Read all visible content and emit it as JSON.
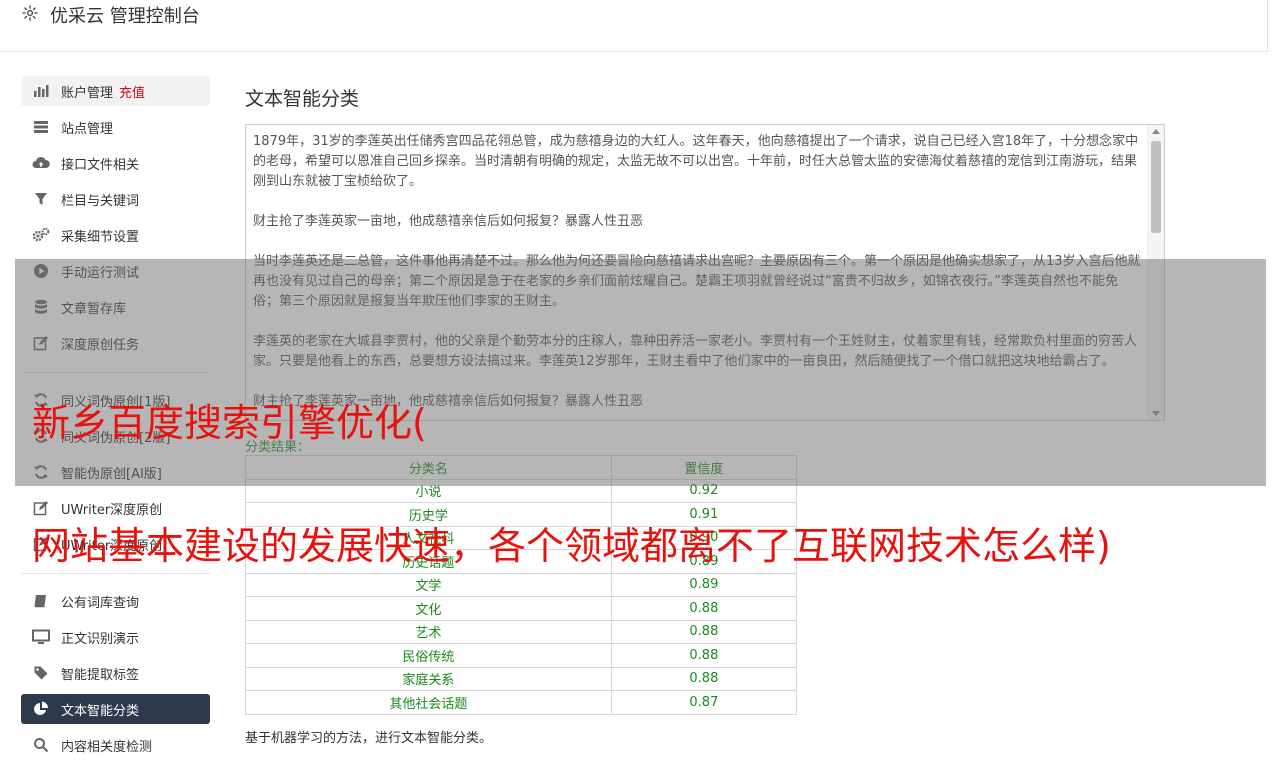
{
  "header": {
    "title": "优采云 管理控制台",
    "gear_icon": "gear-icon"
  },
  "sidebar": {
    "items": [
      {
        "label": "账户管理",
        "extra": "充值",
        "icon": "bar-chart-icon"
      },
      {
        "label": "站点管理",
        "icon": "server-icon"
      },
      {
        "label": "接口文件相关",
        "icon": "cloud-upload-icon"
      },
      {
        "label": "栏目与关键词",
        "icon": "filter-icon"
      },
      {
        "label": "采集细节设置",
        "icon": "gears-icon"
      },
      {
        "label": "手动运行测试",
        "icon": "play-icon"
      },
      {
        "label": "文章暂存库",
        "icon": "database-icon"
      },
      {
        "label": "深度原创任务",
        "icon": "edit-icon"
      },
      {
        "label": "同义词伪原创[1版]",
        "icon": "refresh-icon"
      },
      {
        "label": "同义词伪原创[2版]",
        "icon": "refresh-icon"
      },
      {
        "label": "智能伪原创[AI版]",
        "icon": "refresh-icon"
      },
      {
        "label": "UWriter深度原创",
        "icon": "edit-icon"
      },
      {
        "label": "UWriter深度原创",
        "icon": "edit-icon"
      },
      {
        "label": "公有词库查询",
        "icon": "book-icon"
      },
      {
        "label": "正文识别演示",
        "icon": "monitor-icon"
      },
      {
        "label": "智能提取标签",
        "icon": "tag-icon"
      },
      {
        "label": "文本智能分类",
        "icon": "pie-chart-icon"
      },
      {
        "label": "内容相关度检测",
        "icon": "search-icon"
      }
    ]
  },
  "main": {
    "title": "文本智能分类",
    "text_paragraphs": [
      "1879年，31岁的李莲英出任储秀宫四品花翎总管，成为慈禧身边的大红人。这年春天，他向慈禧提出了一个请求，说自己已经入宫18年了，十分想念家中的老母，希望可以恩准自己回乡探亲。当时清朝有明确的规定，太监无故不可以出宫。十年前，时任大总管太监的安德海仗着慈禧的宠信到江南游玩，结果刚到山东就被丁宝桢给砍了。",
      "财主抢了李莲英家一亩地，他成慈禧亲信后如何报复？暴露人性丑恶",
      "当时李莲英还是二总管，这件事他再清楚不过。那么他为何还要冒险向慈禧请求出宫呢？主要原因有三个。第一个原因是他确实想家了，从13岁入宫后他就再也没有见过自己的母亲；第二个原因是急于在老家的乡亲们面前炫耀自己。楚霸王项羽就曾经说过“富贵不归故乡，如锦衣夜行。”李莲英自然也不能免俗；第三个原因就是报复当年欺压他们李家的王财主。",
      "李莲英的老家在大城县李贾村，他的父亲是个勤劳本分的庄稼人，靠种田养活一家老小。李贾村有一个王姓财主，仗着家里有钱，经常欺负村里面的穷苦人家。只要是他看上的东西，总要想方设法搞过来。李莲英12岁那年，王财主看中了他们家中的一亩良田，然后随便找了一个借口就把这块地给霸占了。",
      "财主抢了李莲英家一亩地，他成慈禧亲信后如何报复？暴露人性丑恶"
    ],
    "result_label": "分类结果：",
    "table_headers": [
      "分类名",
      "置信度"
    ],
    "table_rows": [
      [
        "小说",
        "0.92"
      ],
      [
        "历史学",
        "0.91"
      ],
      [
        "人文社科",
        "0.90"
      ],
      [
        "历史话题",
        "0.89"
      ],
      [
        "文学",
        "0.89"
      ],
      [
        "文化",
        "0.88"
      ],
      [
        "艺术",
        "0.88"
      ],
      [
        "民俗传统",
        "0.88"
      ],
      [
        "家庭关系",
        "0.88"
      ],
      [
        "其他社会话题",
        "0.87"
      ]
    ],
    "note": "基于机器学习的方法，进行文本智能分类。"
  },
  "overlay": {
    "line1": "新乡百度搜索引擎优化(",
    "line2": "网站基本建设的发展快速，各个领域都离不了互联网技术怎么样)"
  }
}
